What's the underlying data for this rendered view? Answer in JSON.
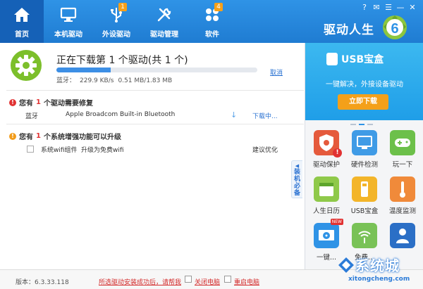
{
  "nav": {
    "items": [
      {
        "label": "首页"
      },
      {
        "label": "本机驱动"
      },
      {
        "label": "外设驱动",
        "badge": "1"
      },
      {
        "label": "驱动管理"
      },
      {
        "label": "软件",
        "badge": "4"
      }
    ]
  },
  "brand": {
    "title": "驱动人生",
    "logo_text": "6"
  },
  "window_controls": [
    "?",
    "✉",
    "☰",
    "—",
    "✕"
  ],
  "download": {
    "title": "正在下载第 1 个驱动(共 1 个)",
    "progress": 0.27,
    "cancel_label": "取消",
    "device": "蓝牙：",
    "speed": "229.9 KB/s",
    "size": "0.51 MB/1.83 MB"
  },
  "repair": {
    "prefix": "您有",
    "count": "1",
    "suffix": "个驱动需要修复",
    "row": {
      "category": "蓝牙",
      "name": "Apple Broadcom Built-in Bluetooth",
      "status": "下载中..."
    }
  },
  "upgrade": {
    "prefix": "您有",
    "count": "1",
    "suffix": "个系统增强功能可以升级",
    "row": {
      "component": "系统wifi组件",
      "desc": "升级为免费wifi",
      "suggestion": "建议优化"
    }
  },
  "sidetab": "装机必备",
  "banner": {
    "title": "USB宝盒",
    "subtitle": "一键解决，外接设备驱动",
    "button": "立即下载"
  },
  "tiles": [
    {
      "label": "驱动保护",
      "color": "#e55a3c",
      "icon": "shield-icon"
    },
    {
      "label": "硬件检测",
      "color": "#3f9be6",
      "icon": "monitor-icon"
    },
    {
      "label": "玩一下",
      "color": "#6cc04a",
      "icon": "gamepad-icon"
    },
    {
      "label": "人生日历",
      "color": "#8fc94a",
      "icon": "calendar-icon"
    },
    {
      "label": "USB宝盒",
      "color": "#f3b52a",
      "icon": "usb-icon"
    },
    {
      "label": "温度监测",
      "color": "#f08a3a",
      "icon": "thermometer-icon"
    },
    {
      "label": "一键...",
      "color": "#2f93e6",
      "icon": "disc-icon",
      "new": "NEW"
    },
    {
      "label": "免费...",
      "color": "#79c257",
      "icon": "wifi-icon"
    },
    {
      "label": "",
      "color": "#2b6fc6",
      "icon": "doctor-icon"
    }
  ],
  "footer": {
    "version": "版本：6.3.33.118",
    "notice": "所选驱动安装成功后，请帮我",
    "opt1": "关闭电脑",
    "opt2": "重启电脑"
  },
  "watermark": {
    "big": "系统城",
    "small": "xitongcheng.com"
  }
}
